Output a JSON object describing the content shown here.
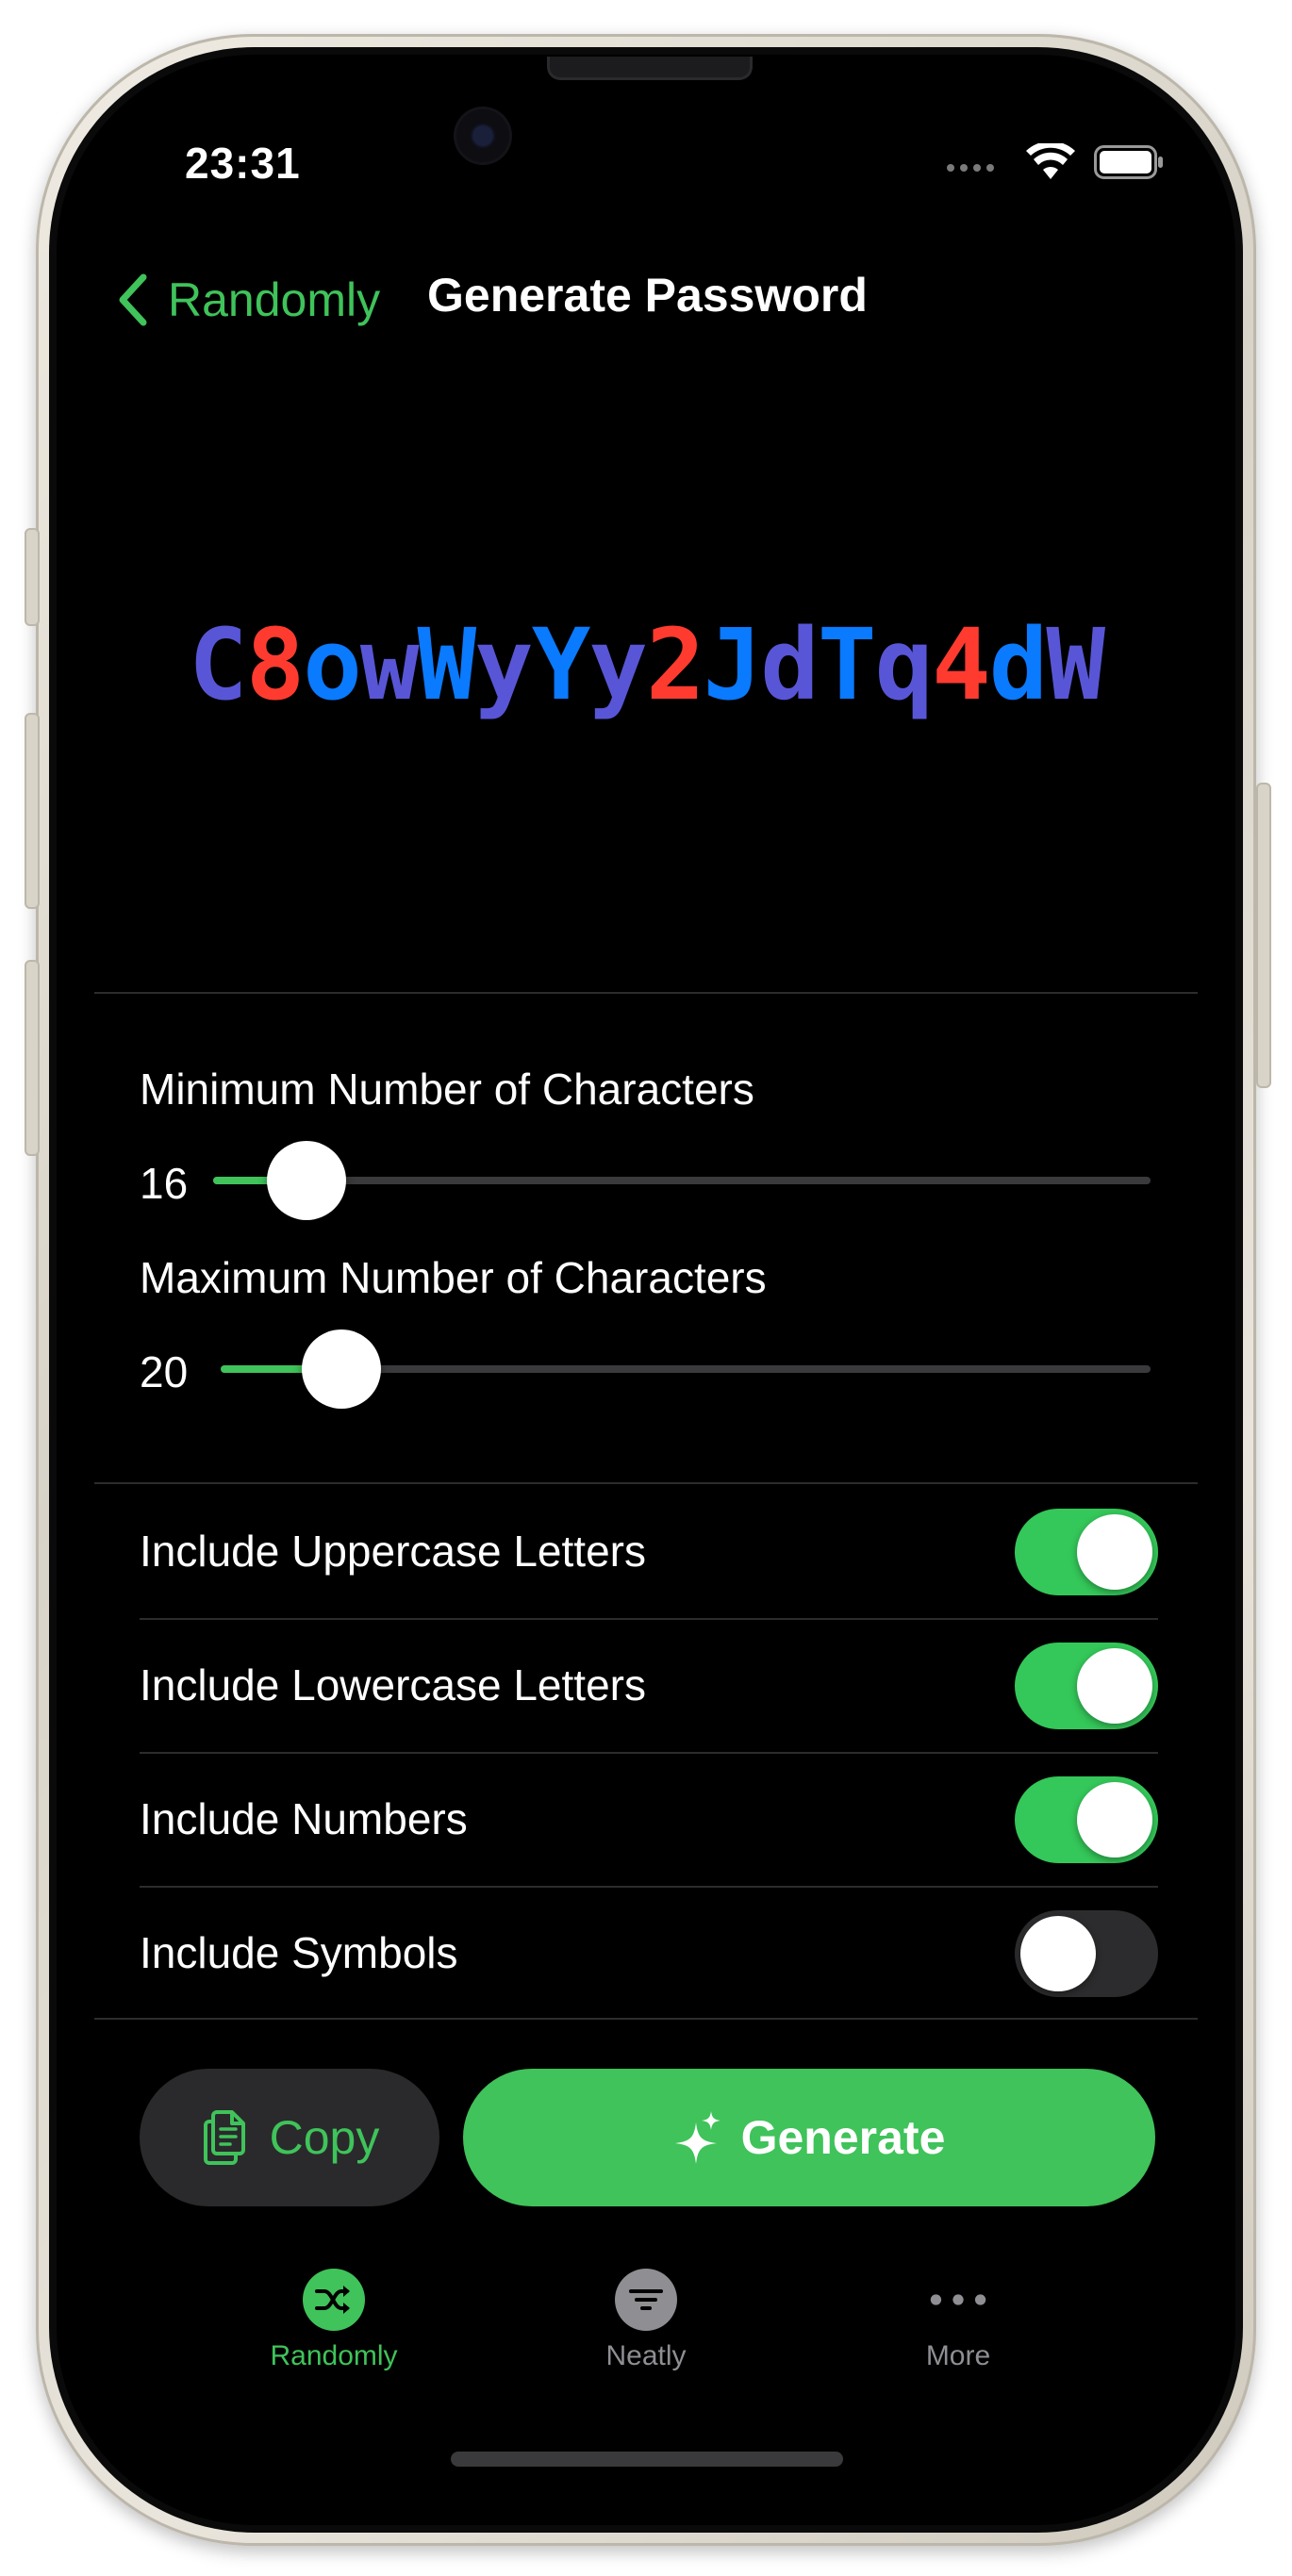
{
  "status_bar": {
    "time": "23:31"
  },
  "nav": {
    "back_label": "Randomly",
    "title": "Generate Password"
  },
  "password": {
    "characters": [
      {
        "char": "C",
        "kind": "letter"
      },
      {
        "char": "8",
        "kind": "digit"
      },
      {
        "char": "o",
        "kind": "letter"
      },
      {
        "char": "w",
        "kind": "letter"
      },
      {
        "char": "W",
        "kind": "letter"
      },
      {
        "char": "y",
        "kind": "letter"
      },
      {
        "char": "Y",
        "kind": "letter"
      },
      {
        "char": "y",
        "kind": "letter"
      },
      {
        "char": "2",
        "kind": "digit"
      },
      {
        "char": "J",
        "kind": "letter"
      },
      {
        "char": "d",
        "kind": "letter"
      },
      {
        "char": "T",
        "kind": "letter"
      },
      {
        "char": "q",
        "kind": "letter"
      },
      {
        "char": "4",
        "kind": "digit"
      },
      {
        "char": "d",
        "kind": "letter"
      },
      {
        "char": "W",
        "kind": "letter"
      }
    ],
    "colors": {
      "letter": "#5856d6",
      "letter_alt": "#0a7aff",
      "digit": "#ff3b30"
    }
  },
  "sliders": {
    "minimum": {
      "label": "Minimum Number of Characters",
      "value": "16",
      "fill_fraction": 0.1
    },
    "maximum": {
      "label": "Maximum Number of Characters",
      "value": "20",
      "fill_fraction": 0.13
    }
  },
  "toggles": [
    {
      "label": "Include Uppercase Letters",
      "on": true
    },
    {
      "label": "Include Lowercase Letters",
      "on": true
    },
    {
      "label": "Include Numbers",
      "on": true
    },
    {
      "label": "Include Symbols",
      "on": false
    }
  ],
  "actions": {
    "copy_label": "Copy",
    "generate_label": "Generate"
  },
  "tabs": [
    {
      "label": "Randomly",
      "icon": "shuffle-icon",
      "active": true
    },
    {
      "label": "Neatly",
      "icon": "filter-lines-icon",
      "active": false
    },
    {
      "label": "More",
      "icon": "ellipsis-icon",
      "active": false
    }
  ],
  "colors": {
    "accent": "#3fc35a",
    "background": "#000000",
    "toggle_on": "#34c759",
    "inactive": "#8e8e93"
  }
}
